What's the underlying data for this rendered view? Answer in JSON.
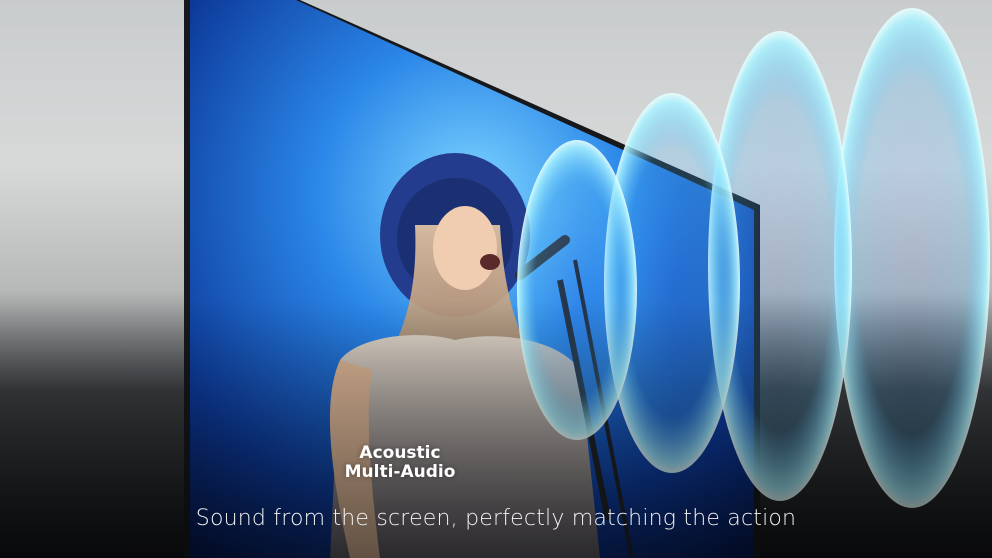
{
  "caption": {
    "line1": "Acoustic",
    "line2": "Multi-Audio",
    "tagline": "Sound from the screen, perfectly matching the action"
  },
  "colors": {
    "screen_blue": "#1e6fd6",
    "wave_cyan": "#7fe9f5",
    "frame": "#16181b"
  },
  "icons": [
    "sound-wave-icon"
  ]
}
